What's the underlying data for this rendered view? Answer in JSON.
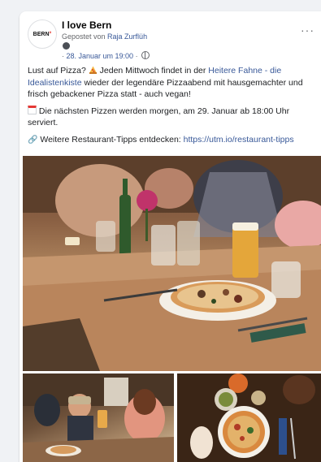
{
  "post": {
    "page_name": "I love Bern",
    "avatar_text": "BERN",
    "avatar_dot": "°",
    "posted_prefix": "Gepostet von ",
    "posted_author": "Raja Zurflüh",
    "timestamp": "28. Januar um 19:00",
    "separator": " · ",
    "visibility_icon": "globe-icon",
    "more_icon": "···",
    "paragraph1_start": "Lust auf Pizza? ",
    "paragraph1_mid": " Jeden Mittwoch findet in der ",
    "paragraph1_link": "Heitere Fahne - die Idealistenkiste",
    "paragraph1_end": " wieder der legendäre Pizzaabend mit hausgemachter und frisch gebackener Pizza statt - auch vegan!",
    "paragraph2": " Die nächsten Pizzen werden morgen, am 29. Januar ab 18:00 Uhr serviert.",
    "paragraph3_text": " Weitere Restaurant-Tipps entdecken: ",
    "paragraph3_link": "https://utm.io/restaurant-tipps",
    "link_glyph": "🔗"
  },
  "photos": {
    "main_alt": "Pizza on a wooden table with beer glasses",
    "left_alt": "Guests dining in restaurant",
    "right_alt": "Overhead view of pizza on table"
  },
  "colors": {
    "link": "#385898",
    "meta": "#65676b",
    "card": "#ffffff"
  }
}
